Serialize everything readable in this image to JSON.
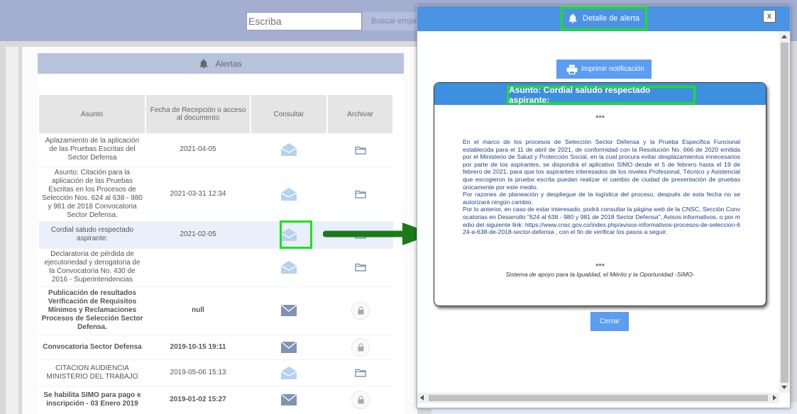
{
  "topbar": {
    "search_placeholder": "Escriba",
    "search_button_label": "Buscar empleo"
  },
  "alerts": {
    "title": "Alertas",
    "columns": [
      "Asunto",
      "Fecha de Recepción o acceso al documento",
      "Consultar",
      "Archivar"
    ],
    "rows": [
      {
        "subject": "Aplazamiento de la aplicación de las Pruebas Escritas del Sector Defensa",
        "date": "2021-04-05",
        "read": true,
        "archive": "folder"
      },
      {
        "subject": "Asunto: Citación para la aplicación de las Pruebas Escritas en los Procesos de Selección Nos. 624 al 638 - 980 y 981 de 2018 Convocatoria Sector Defensa.",
        "date": "2021-03-31 12:34",
        "read": true,
        "archive": "folder"
      },
      {
        "subject": "Cordial saludo respectado aspirante:",
        "date": "2021-02-05",
        "read": true,
        "archive": "folder"
      },
      {
        "subject": "Declaratoria de pérdida de ejecutoriedad y derogatoria de la Convocatoria No. 430 de 2016 - Superintendencias",
        "date": "",
        "read": true,
        "archive": "folder"
      },
      {
        "subject": "Publicación de resultados Verificación de Requisitos Mínimos y Reclamaciones Procesos de Selección Sector Defensa.",
        "date": "null",
        "read": false,
        "archive": "lock"
      },
      {
        "subject": "Convocatoria Sector Defensa",
        "date": "2019-10-15 19:11",
        "read": false,
        "archive": "lock"
      },
      {
        "subject": "CITACION AUDIENCIA MINISTERIO DEL TRABAJO",
        "date": "2019-05-06 15:13",
        "read": true,
        "archive": "folder"
      },
      {
        "subject": "Se habilita SIMO para pago e inscripción - 03 Enero 2019",
        "date": "2019-01-02 15:27",
        "read": false,
        "archive": "lock"
      }
    ]
  },
  "modal": {
    "title": "Detalle de alerta",
    "close_x": "x",
    "print_label": "Imprimir notificación",
    "subject": "Asunto: Cordial saludo respectado aspirante:",
    "stars": "***",
    "paragraphs": [
      "En el marco de los procesos de Selección Sector Defensa y la Prueba Especifica Funcional establecida para el 11 de abril de 2021, de conformidad con la Resolución No. 666 de 2020 emitida por el Ministerio de Salud y Protección Social, en la cual procura evitar desplazamientos innecesarios por parte de los aspirantes, se dispondrá el aplicativo SIMO desde el 5 de febrero hasta el 19 de febrero de 2021, para que los aspirantes interesados de los niveles Profesional, Técnico y Asistencial que escogieron la prueba escrita puedan realizar el cambio de ciudad de presentación de pruebas únicamente por este medio.",
      "Por razones de planeación y despliegue de la logística del proceso, después de esta fecha no se autorizará ningún cambio.",
      "Por lo anterior, en caso de estar interesado, podrá consultar la página web de la CNSC, Sección Convocatorias en Desarrollo \"624 al 638 - 980 y 981 de 2018 Sector Defensa\", Avisos informativos, o por medio del siguiente link: https://www.cnsc.gov.co/index.php/avisos-informativos-procesos-de-seleccion-624-a-638-de-2018-sector-defensa , con el fin de verificar los pasos a seguir."
    ],
    "footer": "Sistema de apoyo para la Igualdad, el Mérito y la Oportunidad -SIMO-",
    "close_label": "Cerrar"
  },
  "colors": {
    "header_blue": "#4b93e3",
    "button_blue": "#5b9df0",
    "highlight_green": "#1de11d",
    "arrow_green": "#1a7a1a",
    "topbar": "#a3aed1",
    "notice_text": "#21408f"
  },
  "icons": {
    "bell": "bell-icon",
    "mail_read": "envelope-open-icon",
    "mail_unread": "envelope-closed-icon",
    "folder": "folder-icon",
    "lock": "lock-icon",
    "print": "printer-icon"
  }
}
